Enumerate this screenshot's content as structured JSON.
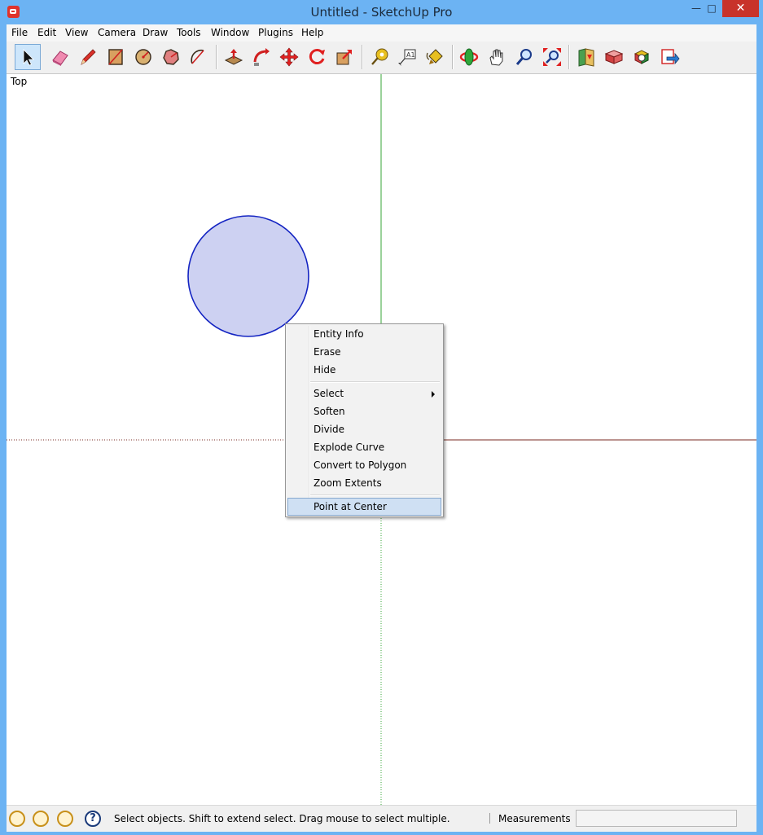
{
  "window": {
    "title": "Untitled - SketchUp Pro",
    "min_label": "—",
    "max_label": "□",
    "close_label": "✕"
  },
  "menubar": {
    "items": [
      "File",
      "Edit",
      "View",
      "Camera",
      "Draw",
      "Tools",
      "Window",
      "Plugins",
      "Help"
    ]
  },
  "toolbar": {
    "tools": [
      "select",
      "eraser",
      "pencil",
      "rectangle",
      "circle",
      "polygon",
      "arc",
      "push-pull",
      "follow-me",
      "move",
      "rotate",
      "scale",
      "tape-measure",
      "text",
      "paint-bucket",
      "orbit",
      "pan",
      "zoom",
      "zoom-extents",
      "get-models",
      "share-model",
      "components",
      "export"
    ],
    "active": "select"
  },
  "viewport": {
    "view_name": "Top",
    "colors": {
      "green_axis": "#37a437",
      "red_axis": "#7a2a20",
      "circle_fill": "#cdd1f2",
      "circle_stroke": "#1424c2"
    }
  },
  "context_menu": {
    "group1": [
      "Entity Info",
      "Erase",
      "Hide"
    ],
    "group2": [
      "Select",
      "Soften",
      "Divide",
      "Explode Curve",
      "Convert to Polygon",
      "Zoom Extents"
    ],
    "group3": [
      "Point at Center"
    ],
    "submenu_item": "Select",
    "highlighted_item": "Point at Center"
  },
  "statusbar": {
    "message": "Select objects. Shift to extend select. Drag mouse to select multiple.",
    "measurements_label": "Measurements",
    "measurements_value": ""
  }
}
